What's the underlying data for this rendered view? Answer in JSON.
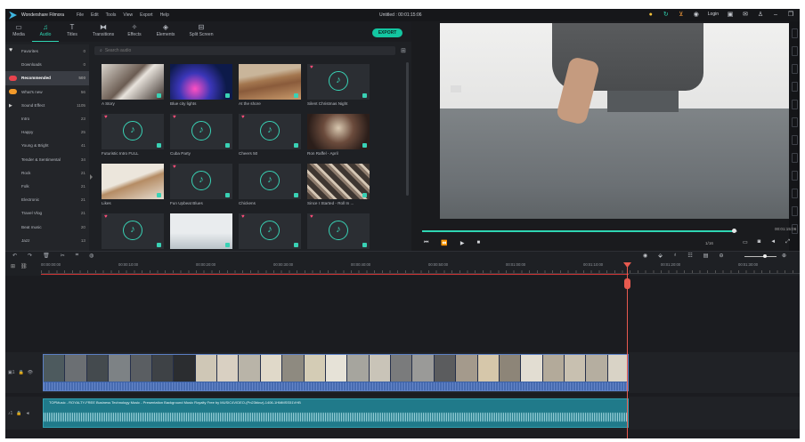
{
  "titlebar": {
    "app_name": "Wondershare Filmora",
    "menu": [
      "File",
      "Edit",
      "Tools",
      "View",
      "Export",
      "Help"
    ],
    "document_title": "Untitled : 00:01:15:06",
    "login_label": "Login"
  },
  "toolbar": {
    "tabs": [
      {
        "label": "Media",
        "icon": "folder-icon"
      },
      {
        "label": "Audio",
        "icon": "music-note-icon"
      },
      {
        "label": "Titles",
        "icon": "text-icon"
      },
      {
        "label": "Transitions",
        "icon": "transition-icon"
      },
      {
        "label": "Effects",
        "icon": "effects-icon"
      },
      {
        "label": "Elements",
        "icon": "elements-icon"
      },
      {
        "label": "Split Screen",
        "icon": "split-screen-icon"
      }
    ],
    "active_tab": "Audio",
    "export_label": "EXPORT"
  },
  "sidebar": {
    "items": [
      {
        "label": "Favorites",
        "count": "0"
      },
      {
        "label": "Downloads",
        "count": "0"
      },
      {
        "label": "Recommended",
        "count": "500"
      },
      {
        "label": "What's new",
        "count": "56"
      },
      {
        "label": "Sound Effect",
        "count": "1105"
      },
      {
        "label": "Intro",
        "count": "23"
      },
      {
        "label": "Happy",
        "count": "25"
      },
      {
        "label": "Young & Bright",
        "count": "41"
      },
      {
        "label": "Tender & Sentimental",
        "count": "34"
      },
      {
        "label": "Rock",
        "count": "21"
      },
      {
        "label": "Folk",
        "count": "21"
      },
      {
        "label": "Electronic",
        "count": "21"
      },
      {
        "label": "Travel Vlog",
        "count": "21"
      },
      {
        "label": "Beat music",
        "count": "20"
      },
      {
        "label": "Jazz",
        "count": "13"
      }
    ]
  },
  "library": {
    "search_placeholder": "Search audio",
    "cards": [
      {
        "label": "A Story",
        "kind": "photo"
      },
      {
        "label": "Blue city lights",
        "kind": "photo"
      },
      {
        "label": "At the shore",
        "kind": "photo"
      },
      {
        "label": "Silent Christmas Night",
        "kind": "note"
      },
      {
        "label": "Futuristic Intro FULL",
        "kind": "note"
      },
      {
        "label": "Cuba Party",
        "kind": "note"
      },
      {
        "label": "Cheers 50",
        "kind": "note"
      },
      {
        "label": "Ron Raffel - April",
        "kind": "photo"
      },
      {
        "label": "Likes",
        "kind": "photo"
      },
      {
        "label": "Fun Upbeat Blues",
        "kind": "note"
      },
      {
        "label": "Chickens",
        "kind": "note"
      },
      {
        "label": "Since I Started - Roll In ...",
        "kind": "photo"
      },
      {
        "label": "",
        "kind": "note"
      },
      {
        "label": "",
        "kind": "photo"
      },
      {
        "label": "",
        "kind": "note"
      },
      {
        "label": "",
        "kind": "note"
      }
    ]
  },
  "preview": {
    "timecode": "00:01:15:06",
    "ratio": "1/16",
    "progress": 0.99
  },
  "timeline": {
    "ruler_ticks": [
      "00:00:00:00",
      "00:00:10:00",
      "00:00:20:00",
      "00:00:30:00",
      "00:00:40:00",
      "00:00:50:00",
      "00:01:00:00",
      "00:01:10:00",
      "00:01:20:00",
      "00:01:30:00"
    ],
    "audio_clip_name": "TOPMusic - ROYALTY-FREE Business Technology Music - Presentation Background Music Royalty Free by MUSIC4VIDEO-(Pn23bkvz)-1406-1HMMSS51VHB"
  },
  "colors": {
    "accent": "#2fd6b3",
    "video_clip": "#3c62a6",
    "audio_clip": "#207a8a",
    "playhead": "#e85a4f"
  }
}
